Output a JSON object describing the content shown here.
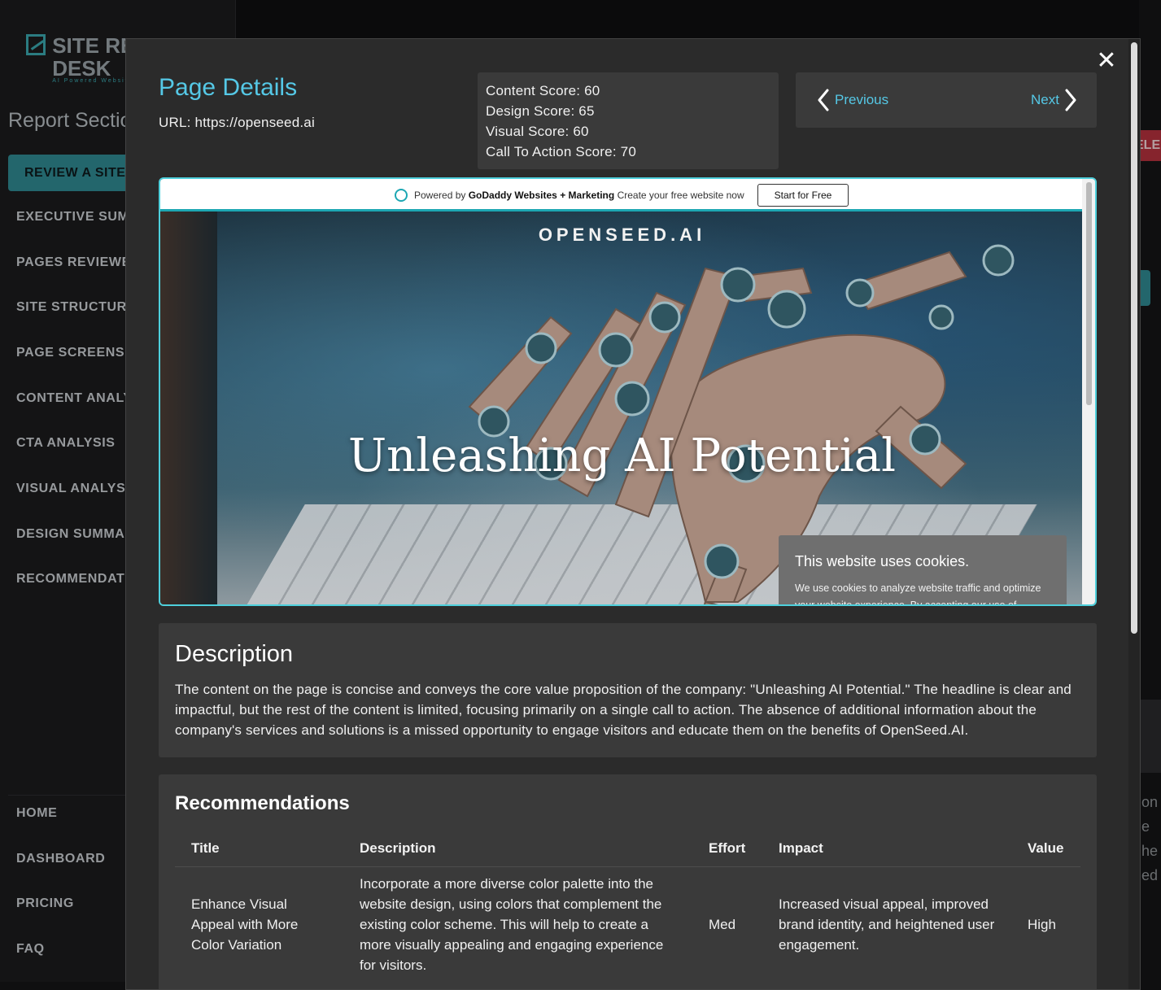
{
  "brand": {
    "name": "SITE REVIEW DESK",
    "tagline": "AI Powered Website Review"
  },
  "sidebar": {
    "section_title": "Report Sections",
    "primary_button": "REVIEW A SITE",
    "items": [
      {
        "label": "EXECUTIVE SUMMARY"
      },
      {
        "label": "PAGES REVIEWED"
      },
      {
        "label": "SITE STRUCTURE"
      },
      {
        "label": "PAGE SCREENSHOTS"
      },
      {
        "label": "CONTENT ANALYSIS"
      },
      {
        "label": "CTA ANALYSIS"
      },
      {
        "label": "VISUAL ANALYSIS"
      },
      {
        "label": "DESIGN SUMMARY"
      },
      {
        "label": "RECOMMENDATIONS"
      }
    ],
    "footer_items": [
      {
        "label": "HOME"
      },
      {
        "label": "DASHBOARD"
      },
      {
        "label": "PRICING"
      },
      {
        "label": "FAQ"
      }
    ]
  },
  "background_right": {
    "red_label": "ELE",
    "text_lines": [
      "on",
      "e",
      "he",
      "ed"
    ]
  },
  "modal": {
    "title": "Page Details",
    "url_line": "URL: https://openseed.ai",
    "scores": [
      "Content Score: 60",
      "Design Score: 65",
      "Visual Score: 60",
      "Call To Action Score: 70"
    ],
    "pager": {
      "previous": "Previous",
      "next": "Next"
    },
    "close_glyph": "✕"
  },
  "preview": {
    "godaddy_bar": {
      "powered_by": "Powered by",
      "brand": "GoDaddy Websites + Marketing",
      "cta_text": "Create your free website now",
      "button": "Start for Free"
    },
    "site_brand": "OPENSEED.AI",
    "headline": "Unleashing AI Potential",
    "cookie_banner": {
      "title": "This website uses cookies.",
      "body": "We use cookies to analyze website traffic and optimize your website experience. By accepting our use of cookies, your data will be aggregated with all other user data."
    }
  },
  "description": {
    "heading": "Description",
    "text": "The content on the page is concise and conveys the core value proposition of the company: \"Unleashing AI Potential.\" The headline is clear and impactful, but the rest of the content is limited, focusing primarily on a single call to action. The absence of additional information about the company's services and solutions is a missed opportunity to engage visitors and educate them on the benefits of OpenSeed.AI."
  },
  "recommendations": {
    "heading": "Recommendations",
    "columns": [
      "Title",
      "Description",
      "Effort",
      "Impact",
      "Value"
    ],
    "rows": [
      {
        "title": "Enhance Visual Appeal with More Color Variation",
        "description": "Incorporate a more diverse color palette into the website design, using colors that complement the existing color scheme. This will help to create a more visually appealing and engaging experience for visitors.",
        "effort": "Med",
        "impact": "Increased visual appeal, improved brand identity, and heightened user engagement.",
        "value": "High"
      }
    ]
  },
  "colors": {
    "accent": "#55c8e6",
    "primary_button": "#2f8890",
    "modal_bg": "#2b2b2b",
    "card_bg": "#3a3a3a"
  }
}
